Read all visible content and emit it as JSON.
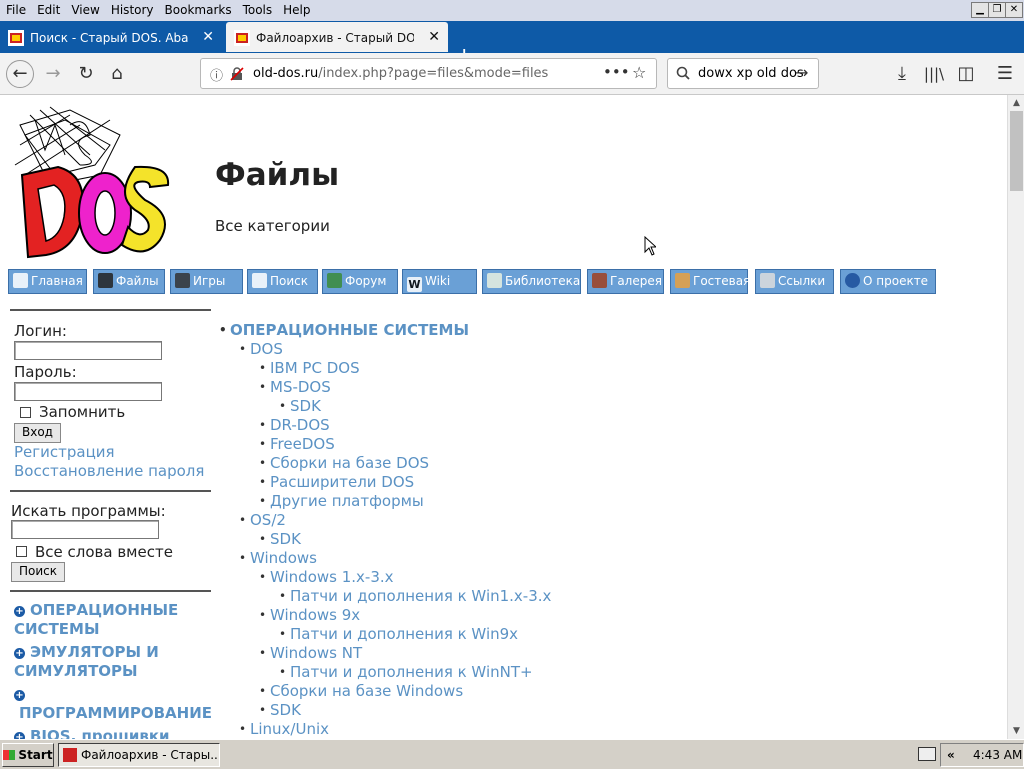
{
  "browser": {
    "menu": [
      "File",
      "Edit",
      "View",
      "History",
      "Bookmarks",
      "Tools",
      "Help"
    ],
    "tabs": [
      {
        "title": "Поиск - Старый DOS. Abandonware",
        "active": false
      },
      {
        "title": "Файлоархив - Старый DOS. Abandonware",
        "active": true
      }
    ],
    "url_host": "old-dos.ru",
    "url_path": "/index.php?page=files&mode=files",
    "search_value": "dowx xp old dos",
    "accent": "#0e5aa7"
  },
  "page": {
    "title": "Файлы",
    "subtitle": "Все категории",
    "link_color": "#5b92c4",
    "nav": [
      "Главная",
      "Файлы",
      "Игры",
      "Поиск",
      "Форум",
      "Wiki",
      "Библиотека",
      "Галерея",
      "Гостевая",
      "Ссылки",
      "О проекте"
    ],
    "login": {
      "login_label": "Логин:",
      "password_label": "Пароль:",
      "remember_label": "Запомнить",
      "submit": "Вход",
      "register": "Регистрация",
      "restore": "Восстановление пароля"
    },
    "search": {
      "label": "Искать программы:",
      "all_words": "Все слова вместе",
      "submit": "Поиск"
    },
    "side_categories": [
      "ОПЕРАЦИОННЫЕ СИСТЕМЫ",
      "ЭМУЛЯТОРЫ И СИМУЛЯТОРЫ",
      "ПРОГРАММИРОВАНИЕ",
      "BIOS, прошивки"
    ],
    "tree": [
      {
        "label": "ОПЕРАЦИОННЫЕ СИСТЕМЫ",
        "level": 0,
        "bold": true
      },
      {
        "label": "DOS",
        "level": 1
      },
      {
        "label": "IBM PC DOS",
        "level": 2
      },
      {
        "label": "MS-DOS",
        "level": 2
      },
      {
        "label": "SDK",
        "level": 3
      },
      {
        "label": "DR-DOS",
        "level": 2
      },
      {
        "label": "FreeDOS",
        "level": 2
      },
      {
        "label": "Сборки на базе DOS",
        "level": 2
      },
      {
        "label": "Расширители DOS",
        "level": 2
      },
      {
        "label": "Другие платформы",
        "level": 2
      },
      {
        "label": "OS/2",
        "level": 1
      },
      {
        "label": "SDK",
        "level": 2
      },
      {
        "label": "Windows",
        "level": 1
      },
      {
        "label": "Windows 1.x-3.x",
        "level": 2
      },
      {
        "label": "Патчи и дополнения к Win1.x-3.x",
        "level": 3
      },
      {
        "label": "Windows 9x",
        "level": 2
      },
      {
        "label": "Патчи и дополнения к Win9x",
        "level": 3
      },
      {
        "label": "Windows NT",
        "level": 2
      },
      {
        "label": "Патчи и дополнения к WinNT+",
        "level": 3
      },
      {
        "label": "Сборки на базе Windows",
        "level": 2
      },
      {
        "label": "SDK",
        "level": 2
      },
      {
        "label": "Linux/Unix",
        "level": 1
      }
    ]
  },
  "taskbar": {
    "start": "Start",
    "window": "Файлоархив - Стары...",
    "clock": "4:43 AM"
  }
}
